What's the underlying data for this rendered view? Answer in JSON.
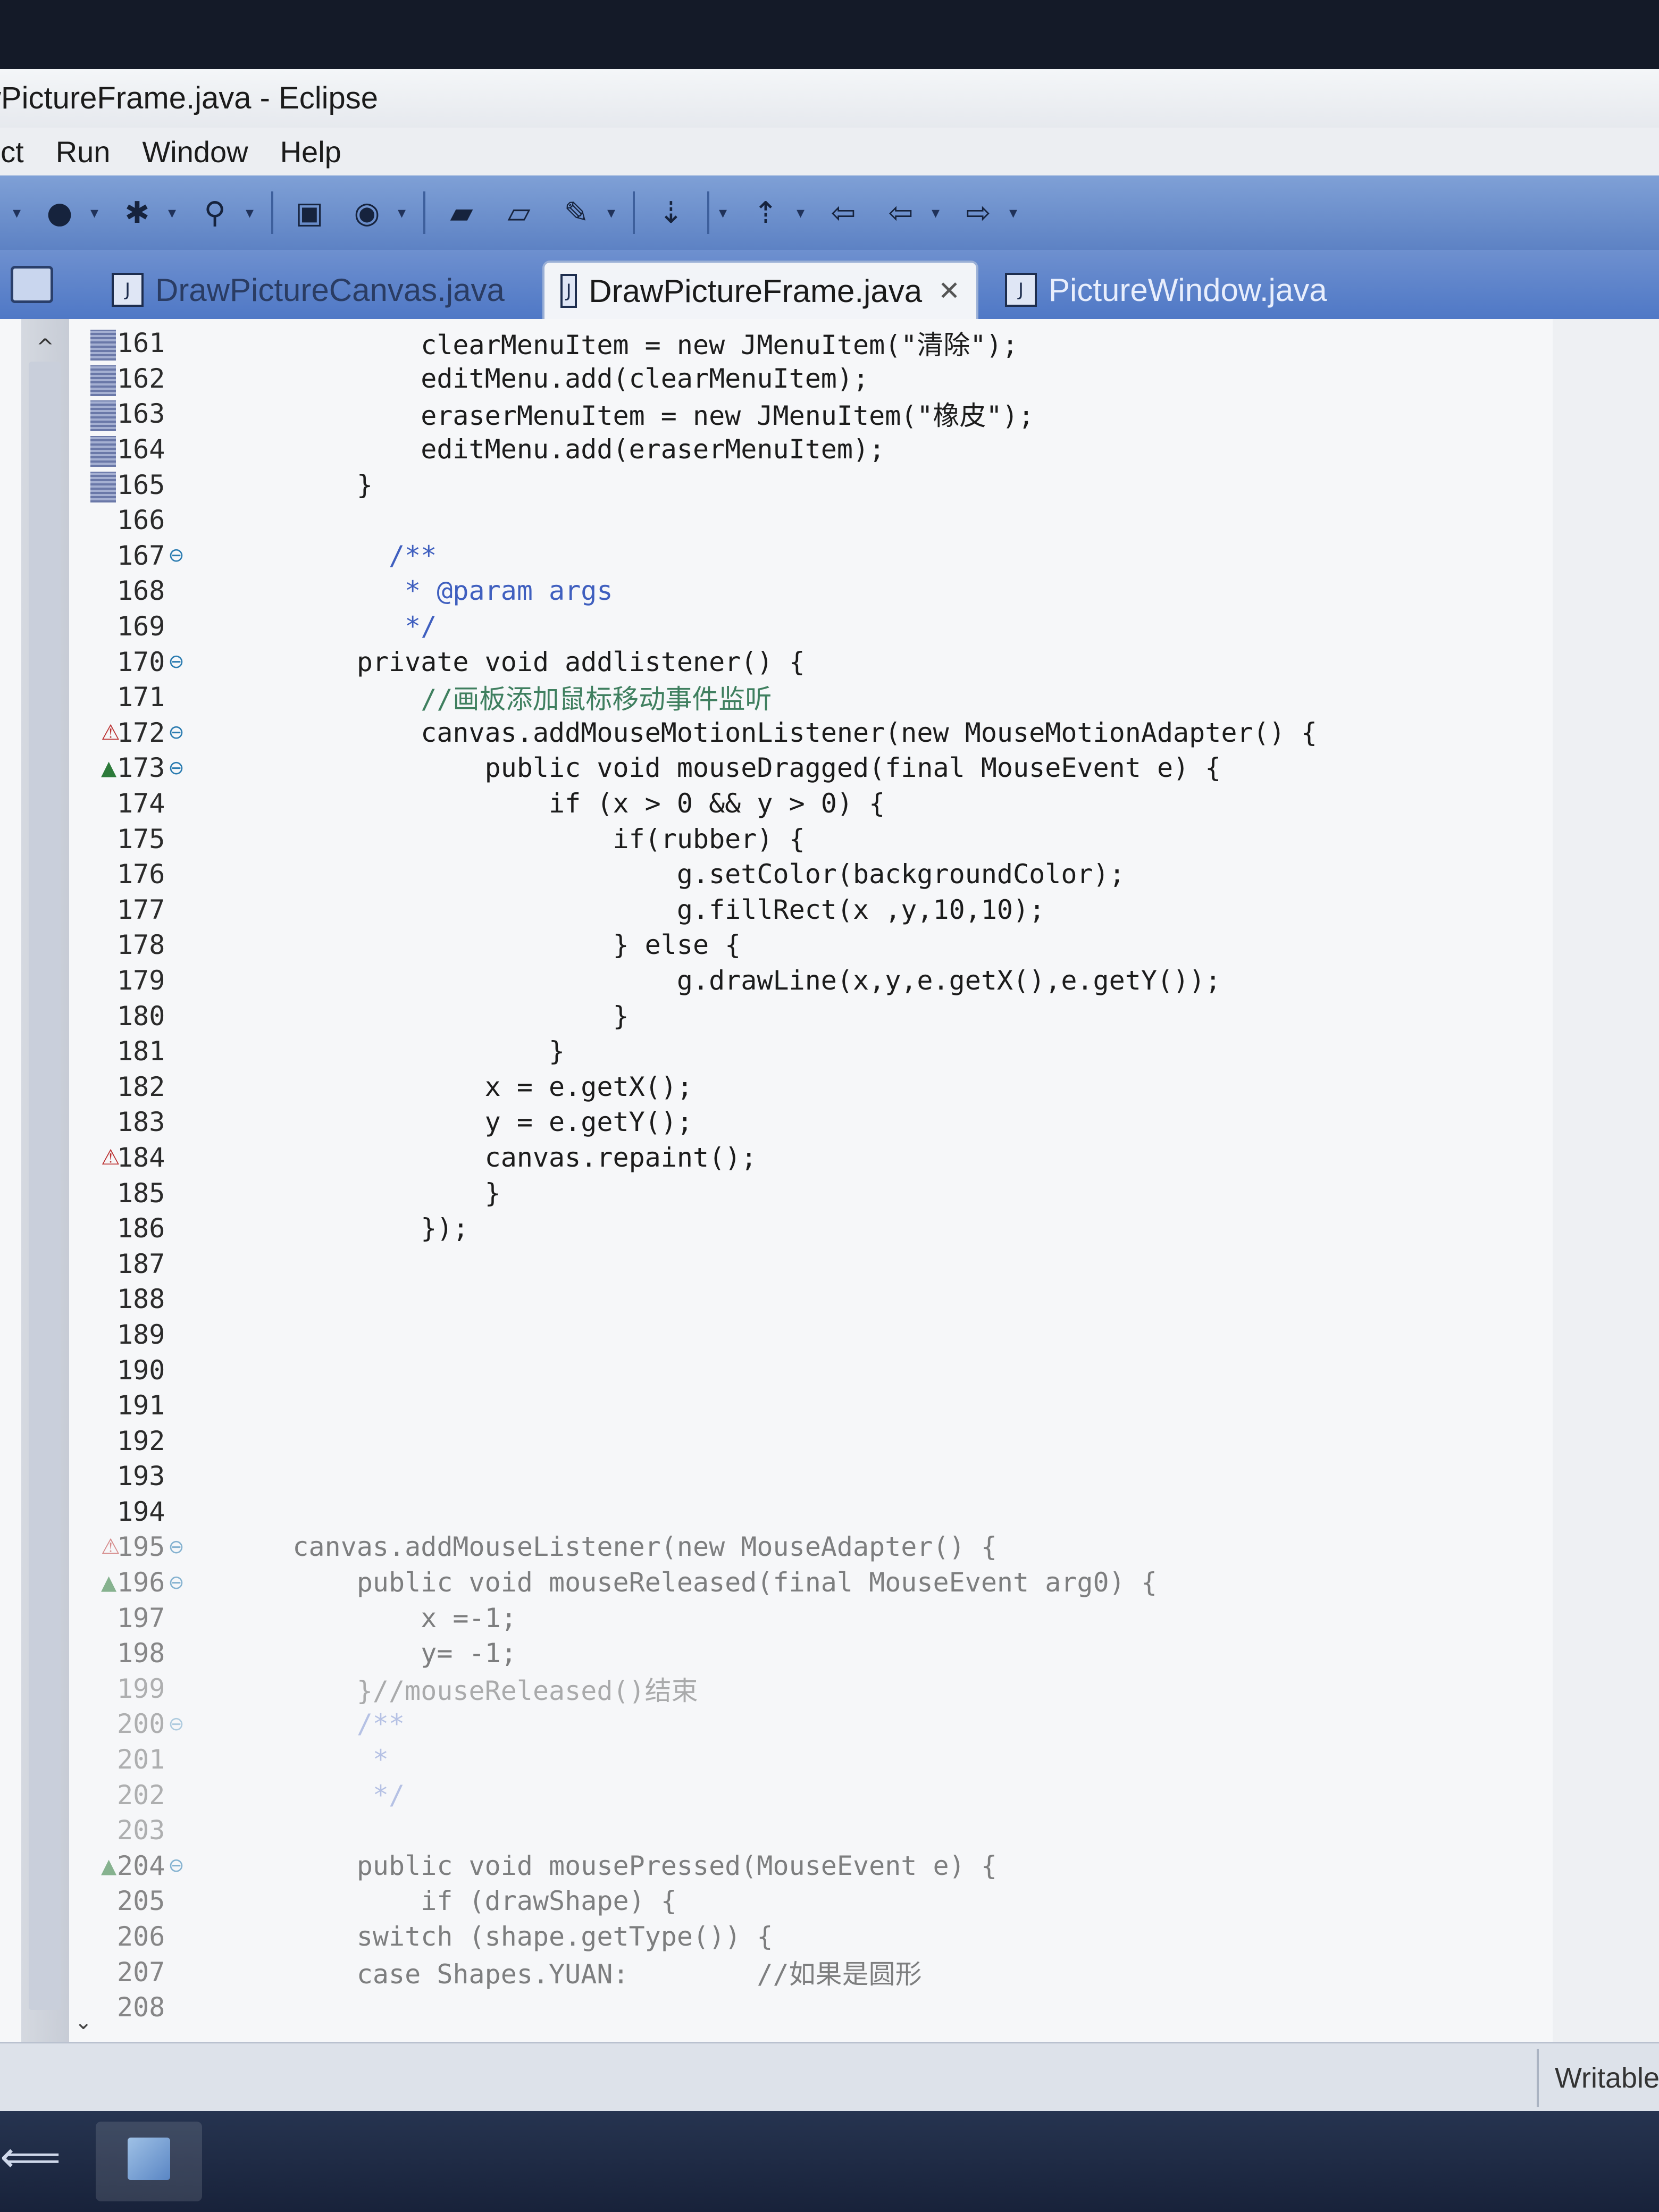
{
  "window": {
    "title": "wPictureFrame.java - Eclipse"
  },
  "menu": {
    "items": [
      "ect",
      "Run",
      "Window",
      "Help"
    ]
  },
  "toolbar": {
    "icons": [
      "run-icon",
      "debug-icon",
      "search-icon",
      "search-refs-icon",
      "new-package-icon",
      "new-class-icon",
      "open-type-icon",
      "open-folder-icon",
      "tools-icon",
      "next-annotation-icon",
      "prev-annotation-icon",
      "back-icon",
      "forward-icon"
    ]
  },
  "tabs": [
    {
      "label": "DrawPictureCanvas.java",
      "active": false
    },
    {
      "label": "DrawPictureFrame.java",
      "active": true,
      "close": "✕"
    },
    {
      "label": "PictureWindow.java",
      "active": false
    }
  ],
  "editor": {
    "lines": [
      {
        "num": "161",
        "code": "            clearMenuItem = new JMenuItem(\"清除\");"
      },
      {
        "num": "162",
        "code": "            editMenu.add(clearMenuItem);"
      },
      {
        "num": "163",
        "code": "            eraserMenuItem = new JMenuItem(\"橡皮\");"
      },
      {
        "num": "164",
        "code": "            editMenu.add(eraserMenuItem);"
      },
      {
        "num": "165",
        "code": "        }"
      },
      {
        "num": "166",
        "code": ""
      },
      {
        "num": "167",
        "code": "          /**"
      },
      {
        "num": "168",
        "code": "           * @param args"
      },
      {
        "num": "169",
        "code": "           */"
      },
      {
        "num": "170",
        "code": "        private void addlistener() {"
      },
      {
        "num": "171",
        "code": "            //画板添加鼠标移动事件监听"
      },
      {
        "num": "172",
        "code": "            canvas.addMouseMotionListener(new MouseMotionAdapter() {"
      },
      {
        "num": "173",
        "code": "                public void mouseDragged(final MouseEvent e) {"
      },
      {
        "num": "174",
        "code": "                    if (x > 0 && y > 0) {"
      },
      {
        "num": "175",
        "code": "                        if(rubber) {"
      },
      {
        "num": "176",
        "code": "                            g.setColor(backgroundColor);"
      },
      {
        "num": "177",
        "code": "                            g.fillRect(x ,y,10,10);"
      },
      {
        "num": "178",
        "code": "                        } else {"
      },
      {
        "num": "179",
        "code": "                            g.drawLine(x,y,e.getX(),e.getY());"
      },
      {
        "num": "180",
        "code": "                        }"
      },
      {
        "num": "181",
        "code": "                    }"
      },
      {
        "num": "182",
        "code": "                x = e.getX();"
      },
      {
        "num": "183",
        "code": "                y = e.getY();"
      },
      {
        "num": "184",
        "code": "                canvas.repaint();"
      },
      {
        "num": "185",
        "code": "                }"
      },
      {
        "num": "186",
        "code": "            });"
      },
      {
        "num": "187",
        "code": ""
      },
      {
        "num": "188",
        "code": ""
      },
      {
        "num": "189",
        "code": ""
      },
      {
        "num": "190",
        "code": ""
      },
      {
        "num": "191",
        "code": ""
      },
      {
        "num": "192",
        "code": ""
      },
      {
        "num": "193",
        "code": ""
      },
      {
        "num": "194",
        "code": ""
      },
      {
        "num": "195",
        "code": "    canvas.addMouseListener(new MouseAdapter() {"
      },
      {
        "num": "196",
        "code": "        public void mouseReleased(final MouseEvent arg0) {"
      },
      {
        "num": "197",
        "code": "            x =-1;"
      },
      {
        "num": "198",
        "code": "            y= -1;"
      },
      {
        "num": "199",
        "code": "        }//mouseReleased()结束"
      },
      {
        "num": "200",
        "code": "        /**"
      },
      {
        "num": "201",
        "code": "         *"
      },
      {
        "num": "202",
        "code": "         */"
      },
      {
        "num": "203",
        "code": ""
      },
      {
        "num": "204",
        "code": "        public void mousePressed(MouseEvent e) {"
      },
      {
        "num": "205",
        "code": "            if (drawShape) {"
      },
      {
        "num": "206",
        "code": "        switch (shape.getType()) {"
      },
      {
        "num": "207",
        "code": "        case Shapes.YUAN:        //如果是圆形"
      },
      {
        "num": "208",
        "code": ""
      }
    ]
  },
  "status": {
    "writable": "Writable"
  }
}
